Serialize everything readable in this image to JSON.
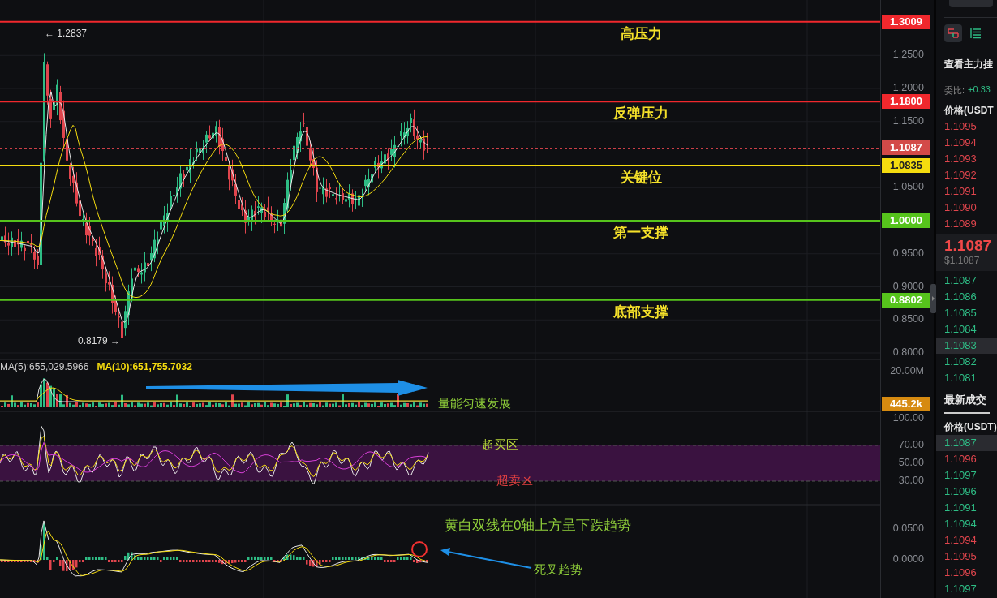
{
  "price_levels": [
    {
      "label": "高压力",
      "price": "1.3009",
      "color": "#f0282d"
    },
    {
      "label": "反弹压力",
      "price": "1.1800",
      "color": "#f0282d"
    },
    {
      "label": "关键位",
      "price": "1.0835",
      "color": "#f5dc0f"
    },
    {
      "label": "第一支撑",
      "price": "1.0000",
      "color": "#56c41c"
    },
    {
      "label": "底部支撑",
      "price": "0.8802",
      "color": "#56c41c"
    }
  ],
  "price_axis": [
    "1.2500",
    "1.2000",
    "1.1500",
    "1.0500",
    "0.9500",
    "0.9000",
    "0.8500",
    "0.8000"
  ],
  "last_price_tag": "1.1087",
  "high_marker": "← 1.2837",
  "low_marker": "0.8179 →",
  "volume": {
    "ma5": "MA(5):655,029.5966",
    "ma10": "MA(10):651,755.7032",
    "axis": [
      "20.00M"
    ],
    "last_tag": "445.2k",
    "note": "量能匀速发展"
  },
  "rsi": {
    "axis": [
      "100.00",
      "70.00",
      "50.00",
      "30.00"
    ],
    "overbought": "超买区",
    "oversold": "超卖区"
  },
  "macd": {
    "axis": [
      "0.0500",
      "0.0000"
    ],
    "note": "黄白双线在0轴上方呈下跌趋势",
    "cross_note": "死叉趋势"
  },
  "order_book": {
    "view_tabs": [
      {
        "selected": true
      },
      {
        "selected": false
      }
    ],
    "title": "查看主力挂",
    "ratio_label": "委比:",
    "ratio_value": "+0.33",
    "header": "价格(USDT",
    "asks": [
      "1.1095",
      "1.1094",
      "1.1093",
      "1.1092",
      "1.1091",
      "1.1090",
      "1.1089"
    ],
    "last_price": "1.1087",
    "last_price_usd": "$1.1087",
    "bids": [
      {
        "price": "1.1087",
        "selected": false
      },
      {
        "price": "1.1086",
        "selected": false
      },
      {
        "price": "1.1085",
        "selected": false
      },
      {
        "price": "1.1084",
        "selected": false
      },
      {
        "price": "1.1083",
        "selected": true
      },
      {
        "price": "1.1082",
        "selected": false
      },
      {
        "price": "1.1081",
        "selected": false
      }
    ]
  },
  "trades": {
    "title": "最新成交",
    "header": "价格(USDT)",
    "rows": [
      {
        "price": "1.1087",
        "color": "#2ebd85",
        "selected": true
      },
      {
        "price": "1.1096",
        "color": "#e0454d",
        "selected": false
      },
      {
        "price": "1.1097",
        "color": "#2ebd85",
        "selected": false
      },
      {
        "price": "1.1096",
        "color": "#2ebd85",
        "selected": false
      },
      {
        "price": "1.1091",
        "color": "#2ebd85",
        "selected": false
      },
      {
        "price": "1.1094",
        "color": "#2ebd85",
        "selected": false
      },
      {
        "price": "1.1094",
        "color": "#e0454d",
        "selected": false
      },
      {
        "price": "1.1095",
        "color": "#e0454d",
        "selected": false
      },
      {
        "price": "1.1096",
        "color": "#e0454d",
        "selected": false
      },
      {
        "price": "1.1097",
        "color": "#2ebd85",
        "selected": false
      }
    ]
  }
}
